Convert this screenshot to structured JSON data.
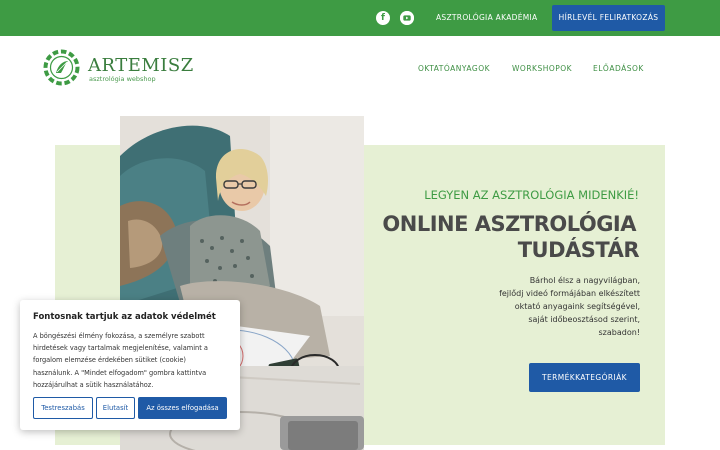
{
  "topbar": {
    "facebook_icon": "facebook-icon",
    "youtube_icon": "youtube-icon",
    "academy_link": "ASZTROLÓGIA AKADÉMIA",
    "newsletter_button": "HÍRLEVÉL FELIRATKOZÁS"
  },
  "logo": {
    "name": "ARTEMISZ",
    "subtitle": "asztrológia webshop"
  },
  "nav": {
    "items": [
      "OKTATÓANYAGOK",
      "WORKSHOPOK",
      "ELŐADÁSOK"
    ]
  },
  "hero": {
    "tagline": "LEGYEN AZ ASZTROLÓGIA MIDENKIÉ!",
    "title_line1": "ONLINE ASZTROLÓGIA",
    "title_line2": "TUDÁSTÁR",
    "description_lines": [
      "Bárhol élsz a nagyvilágban,",
      "fejlődj videó formájában elkészített",
      "oktató anyagaink segítségével,",
      "saját időbeosztásod szerint,",
      "szabadon!"
    ],
    "cta_button": "TERMÉKKATEGÓRIÁK"
  },
  "cookie": {
    "title": "Fontosnak tartjuk az adatok védelmét",
    "text_lines": [
      "A böngészési élmény fokozása, a személyre szabott",
      "hirdetések vagy tartalmak megjelenítése, valamint a",
      "forgalom elemzése érdekében sütiket (cookie)",
      "használunk. A \"Mindet elfogadom\" gombra kattintva",
      "hozzájárulhat a sütik használatához."
    ],
    "customize_button": "Testreszabás",
    "reject_button": "Elutasít",
    "accept_all_button": "Az összes elfogadása"
  },
  "colors": {
    "brand_green": "#3e9b44",
    "accent_blue": "#1f5aa6",
    "hero_background": "#e6f0d4",
    "title_gray": "#4a4a4a"
  }
}
